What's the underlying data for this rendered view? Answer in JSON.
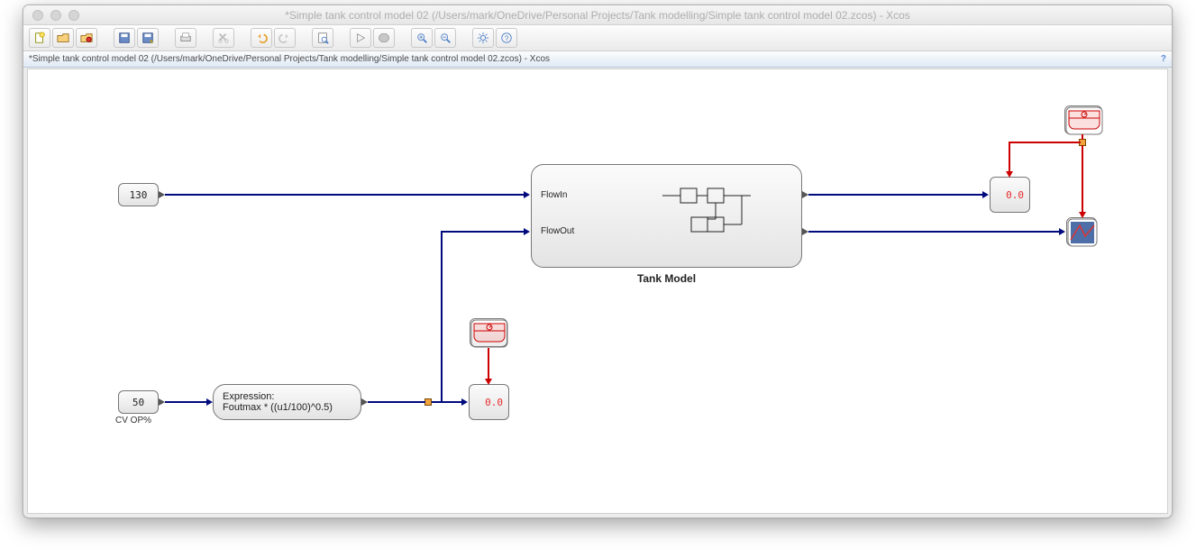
{
  "window": {
    "title": "*Simple tank control model 02 (/Users/mark/OneDrive/Personal Projects/Tank modelling/Simple tank control model 02.zcos) - Xcos"
  },
  "doctab": {
    "title": "*Simple tank control model 02 (/Users/mark/OneDrive/Personal Projects/Tank modelling/Simple tank control model 02.zcos) - Xcos",
    "help": "?"
  },
  "toolbar": {
    "icons": {
      "new": "new-file-icon",
      "open": "open-icon",
      "open_scilab": "open-scilab-icon",
      "save": "save-icon",
      "save_as": "save-as-icon",
      "print": "print-icon",
      "cut": "cut-icon",
      "undo": "undo-icon",
      "redo": "redo-icon",
      "fit": "fit-page-icon",
      "start": "start-icon",
      "stop": "stop-icon",
      "zoom_in": "zoom-in-icon",
      "zoom_out": "zoom-out-icon",
      "settings": "settings-icon",
      "help": "help-icon"
    }
  },
  "canvas": {
    "blocks": {
      "const1": {
        "value": "130"
      },
      "const2": {
        "value": "50",
        "label": "CV OP%"
      },
      "expr": {
        "title": "Expression:",
        "body": "Foutmax * ((u1/100)^0.5)"
      },
      "super": {
        "name": "Tank Model",
        "port_in1": "FlowIn",
        "port_in2": "FlowOut"
      },
      "display1": {
        "value": "0.0"
      },
      "display2": {
        "value": "0.0"
      },
      "clock1": {
        "name": "clock-icon"
      },
      "clock2": {
        "name": "clock-icon"
      },
      "scope": {
        "name": "scope-icon"
      }
    }
  }
}
